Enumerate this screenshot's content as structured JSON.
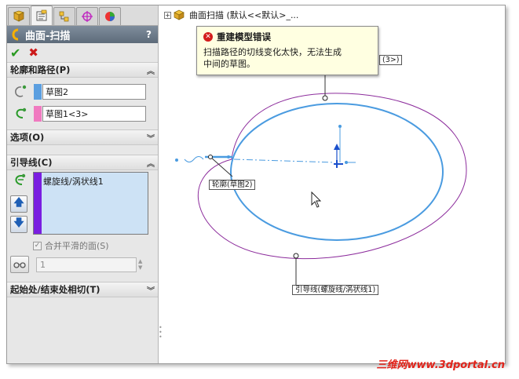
{
  "tabs": [
    {
      "icon": "feature-manager-icon",
      "active": false
    },
    {
      "icon": "property-manager-icon",
      "active": true
    },
    {
      "icon": "configuration-manager-icon",
      "active": false
    },
    {
      "icon": "dimxpert-icon",
      "active": false
    },
    {
      "icon": "display-manager-icon",
      "active": false
    }
  ],
  "property_manager": {
    "title": "曲面-扫描",
    "help": "?"
  },
  "groups": {
    "profile_path": {
      "title": "轮廓和路径(P)",
      "profile_value": "草图2",
      "path_value": "草图1<3>",
      "profile_color": "#5b9fe0",
      "path_color": "#f07ac0"
    },
    "options": {
      "title": "选项(O)"
    },
    "guide_curves": {
      "title": "引导线(C)",
      "items": [
        "螺旋线/涡状线1"
      ],
      "merge_smooth_label": "合并平滑的面(S)",
      "spin_value": "1"
    },
    "tangency": {
      "title": "起始处/结束处相切(T)"
    }
  },
  "tree": {
    "item_text": "曲面扫描  (默认<<默认>_..."
  },
  "tooltip": {
    "title": "重建模型错误",
    "body_line1": "扫描路径的切线变化太快，无法生成",
    "body_line2": "中间的草图。"
  },
  "graphics_labels": {
    "path_callout": "(3>)",
    "profile_callout": "轮廓(草图2)",
    "guide_callout": "引导线(螺旋线/涡状线1)"
  },
  "watermark": "三维网www.3dportal.cn",
  "colors": {
    "sketch_blue": "#4a9be0",
    "helix_purple": "#8c2c9c",
    "title_bar": "#6b7a89",
    "error_red": "#d31c1c",
    "guide_bar": "#7a1ee0"
  }
}
